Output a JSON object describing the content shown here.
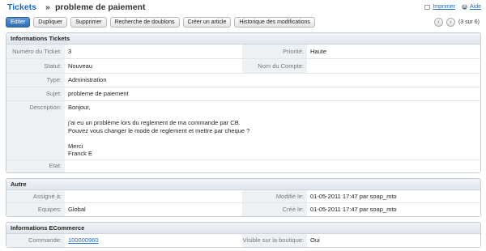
{
  "header": {
    "module": "Tickets",
    "separator": "»",
    "title": "probleme de paiement",
    "print_label": "Imprimer",
    "help_label": "Aide"
  },
  "toolbar": {
    "buttons": [
      "Editer",
      "Dupliquer",
      "Supprimer",
      "Recherche de doublons",
      "Créer un article",
      "Historique des modifications"
    ]
  },
  "pager": {
    "text": "(3 sur 6)",
    "prev_glyph": "‹",
    "next_glyph": "›"
  },
  "sections": {
    "info": {
      "title": "Informations Tickets",
      "numero_label": "Numéro du Ticket:",
      "numero_value": "3",
      "priorite_label": "Priorité:",
      "priorite_value": "Haute",
      "statut_label": "Statut:",
      "statut_value": "Nouveau",
      "compte_label": "Nom du Compte:",
      "compte_value": "",
      "type_label": "Type:",
      "type_value": "Administration",
      "sujet_label": "Sujet:",
      "sujet_value": "probleme de paiement",
      "description_label": "Description:",
      "description_lines": [
        "Bonjour,",
        "",
        "j'ai eu un problème lors du reglement de ma commande par CB.",
        "Pouvez vous changer le mode de reglement et mettre par cheque ?",
        "",
        "Merci",
        "Franck E"
      ],
      "etat_label": "Etat:",
      "etat_value": ""
    },
    "autre": {
      "title": "Autre",
      "assigne_label": "Assigné à:",
      "assigne_value": "",
      "modifie_label": "Modifié le:",
      "modifie_value": "01-05-2011 17:47 par soap_mto",
      "equipes_label": "Equipes:",
      "equipes_value": "Global",
      "cree_label": "Créé le:",
      "cree_value": "01-05-2011 17:47 par soap_mto"
    },
    "ecommerce": {
      "title": "Informations ECommerce",
      "commande_label": "Commande:",
      "commande_value": "100000960",
      "visible_label": "Visible sur la boutique:",
      "visible_value": "Oui"
    }
  },
  "colors": {
    "accent": "#1a6ac0",
    "primary_button": "#2f6db3",
    "panel_bg": "#eef1f4",
    "panel_border": "#c4cdd6"
  }
}
